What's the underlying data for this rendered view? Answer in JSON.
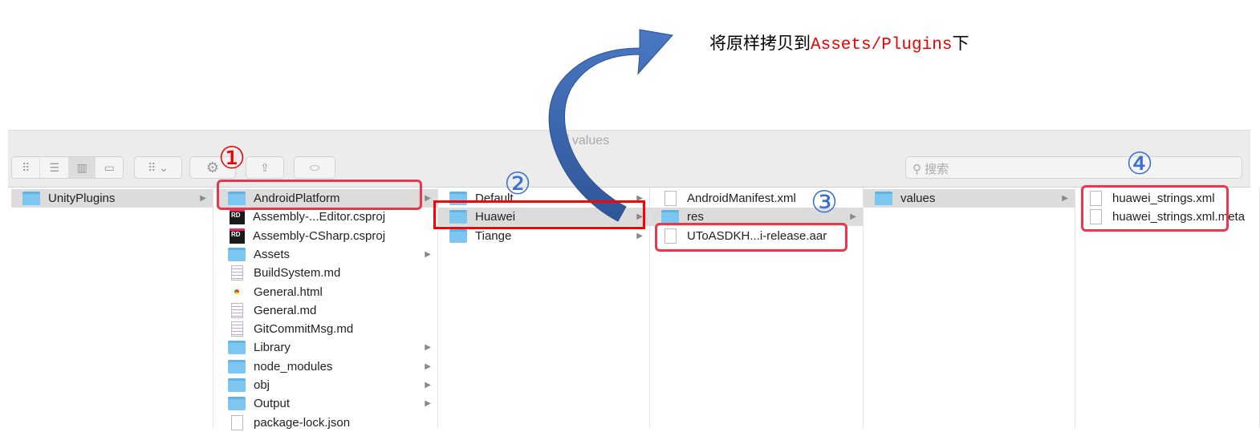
{
  "annotation": {
    "prefix": "将原样拷贝到",
    "path": "Assets/Plugins",
    "suffix": "下",
    "markers": [
      "①",
      "②",
      "③",
      "④"
    ],
    "arrow_color": "#3d66b0",
    "highlight_color": "#e8384f"
  },
  "window": {
    "title": "values"
  },
  "toolbar": {
    "search_placeholder": "搜索"
  },
  "columns": [
    {
      "items": [
        {
          "label": "UnityPlugins",
          "type": "folder",
          "selected": true
        }
      ]
    },
    {
      "items": [
        {
          "label": "AndroidPlatform",
          "type": "folder",
          "selected": true
        },
        {
          "label": "Assembly-...Editor.csproj",
          "type": "rider"
        },
        {
          "label": "Assembly-CSharp.csproj",
          "type": "rider"
        },
        {
          "label": "Assets",
          "type": "folder"
        },
        {
          "label": "BuildSystem.md",
          "type": "md"
        },
        {
          "label": "General.html",
          "type": "html"
        },
        {
          "label": "General.md",
          "type": "md"
        },
        {
          "label": "GitCommitMsg.md",
          "type": "md"
        },
        {
          "label": "Library",
          "type": "folder"
        },
        {
          "label": "node_modules",
          "type": "folder"
        },
        {
          "label": "obj",
          "type": "folder"
        },
        {
          "label": "Output",
          "type": "folder"
        },
        {
          "label": "package-lock.json",
          "type": "file"
        }
      ]
    },
    {
      "items": [
        {
          "label": "Default",
          "type": "folder"
        },
        {
          "label": "Huawei",
          "type": "folder",
          "selected": true
        },
        {
          "label": "Tiange",
          "type": "folder"
        }
      ]
    },
    {
      "items": [
        {
          "label": "AndroidManifest.xml",
          "type": "file"
        },
        {
          "label": "res",
          "type": "folder",
          "selected": true
        },
        {
          "label": "UToASDKH...i-release.aar",
          "type": "file"
        }
      ]
    },
    {
      "items": [
        {
          "label": "values",
          "type": "folder",
          "selected": true
        }
      ]
    },
    {
      "items": [
        {
          "label": "huawei_strings.xml",
          "type": "file"
        },
        {
          "label": "huawei_strings.xml.meta",
          "type": "file"
        }
      ]
    }
  ]
}
